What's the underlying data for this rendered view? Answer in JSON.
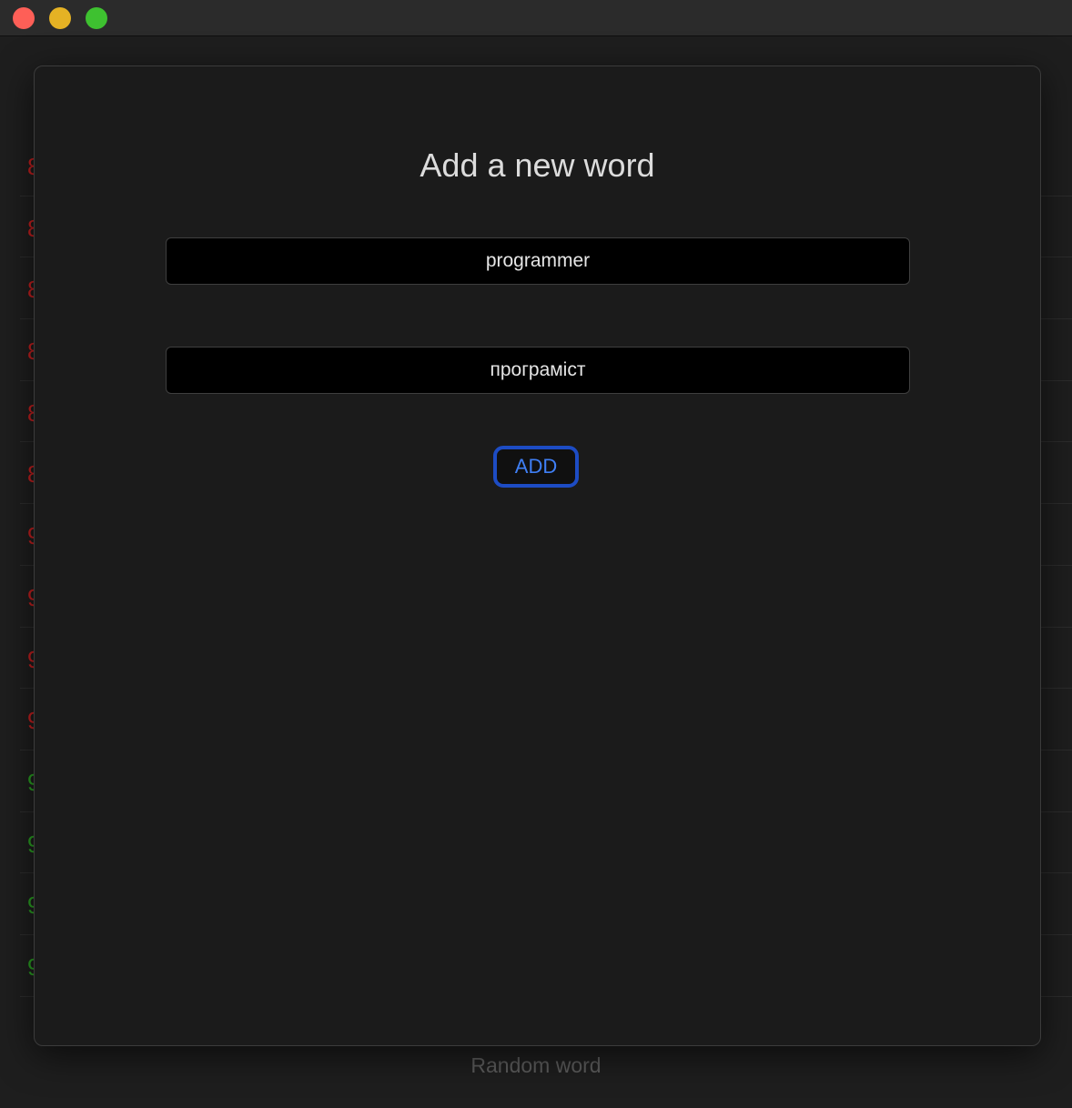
{
  "window": {
    "controls": [
      "close",
      "minimize",
      "maximize"
    ],
    "colors": {
      "close": "#fe5f57",
      "minimize": "#e5b224",
      "maximize": "#3ec130"
    }
  },
  "background": {
    "rows": [
      {
        "value": "8",
        "color": "red"
      },
      {
        "value": "8",
        "color": "red"
      },
      {
        "value": "8",
        "color": "red"
      },
      {
        "value": "8",
        "color": "red"
      },
      {
        "value": "8",
        "color": "red"
      },
      {
        "value": "8",
        "color": "red"
      },
      {
        "value": "9",
        "color": "red"
      },
      {
        "value": "9",
        "color": "red"
      },
      {
        "value": "9",
        "color": "red"
      },
      {
        "value": "9",
        "color": "red"
      },
      {
        "value": "9",
        "color": "green"
      },
      {
        "value": "9",
        "color": "green"
      },
      {
        "value": "9",
        "color": "green"
      },
      {
        "value": "9",
        "color": "green"
      }
    ],
    "footer_button": "Random word"
  },
  "sheet": {
    "title": "Add a new word",
    "word_field": {
      "value": "programmer"
    },
    "translation_field": {
      "value": "програміст"
    },
    "add_button": "ADD",
    "accent_color": "#1d4cc4"
  }
}
